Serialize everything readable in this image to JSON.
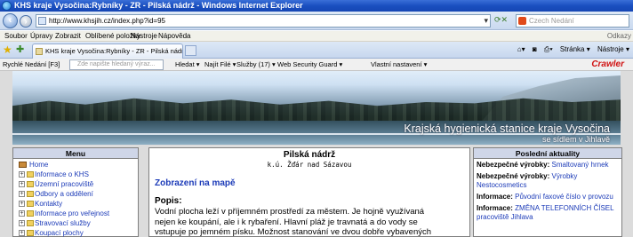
{
  "window": {
    "title": "KHS kraje Vysočina:Rybníky - ZR - Pilská nádrž - Windows Internet Explorer"
  },
  "addressbar": {
    "url": "http://www.khsjih.cz/index.php?id=95",
    "search_placeholder": "Czech Nedání"
  },
  "menubar": {
    "items": [
      "Soubor",
      "Úpravy",
      "Zobrazit",
      "Oblíbené položky",
      "Nástroje",
      "Nápověda"
    ],
    "links_label": "Odkazy"
  },
  "tabs": {
    "active_tab": "KHS kraje Vysočina:Rybníky - ZR - Pilská nádrž",
    "tools": [
      "Stránka ▾",
      "Nástroje ▾"
    ]
  },
  "toolbar": {
    "quick_search": "Rychlé Nedání [F3]",
    "search_placeholder": "Zde napište hledaný výraz...",
    "items": [
      "Hledat ▾",
      "Najít Filé ▾",
      "Služby (17) ▾",
      "Web Security Guard ▾",
      "Vlastní nastavení ▾"
    ],
    "brand": "Crawler"
  },
  "banner": {
    "heading": "Krajská hygienická stanice kraje Vysočina",
    "subheading": "se sídlem v Jihlavě"
  },
  "menu": {
    "title": "Menu",
    "home": "Home",
    "items": [
      "Informace o KHS",
      "Územní pracoviště",
      "Odbory a oddělení",
      "Kontakty",
      "Informace pro veřejnost",
      "Stravovací služby",
      "Koupací plochy"
    ]
  },
  "content": {
    "title": "Pilská nádrž",
    "subtitle": "k.ú. Žďár nad Sázavou",
    "map_link": "Zobrazení na mapě",
    "section": "Popis:",
    "text_lines": [
      "Vodní plocha leží v příjemném prostředí za městem. Je hojně využívaná",
      "nejen ke koupání, ale i k rybaření. Hlavní pláž je travnatá a do vody se",
      "vstupuje po jemném písku. Možnost stanování ve dvou dobře vybavených"
    ]
  },
  "news": {
    "title": "Poslední aktuality",
    "items": [
      {
        "label": "Nebezpečné výrobky:",
        "link": "Smaltovaný hrnek"
      },
      {
        "label": "Nebezpečné výrobky:",
        "link": "Výrobky Nestocosmetics"
      },
      {
        "label": "Informace:",
        "link": "Původní faxové číslo v provozu"
      },
      {
        "label": "Informace:",
        "link": "ZMĚNA TELEFONNÍCH ČÍSEL pracoviště Jihlava"
      }
    ]
  }
}
